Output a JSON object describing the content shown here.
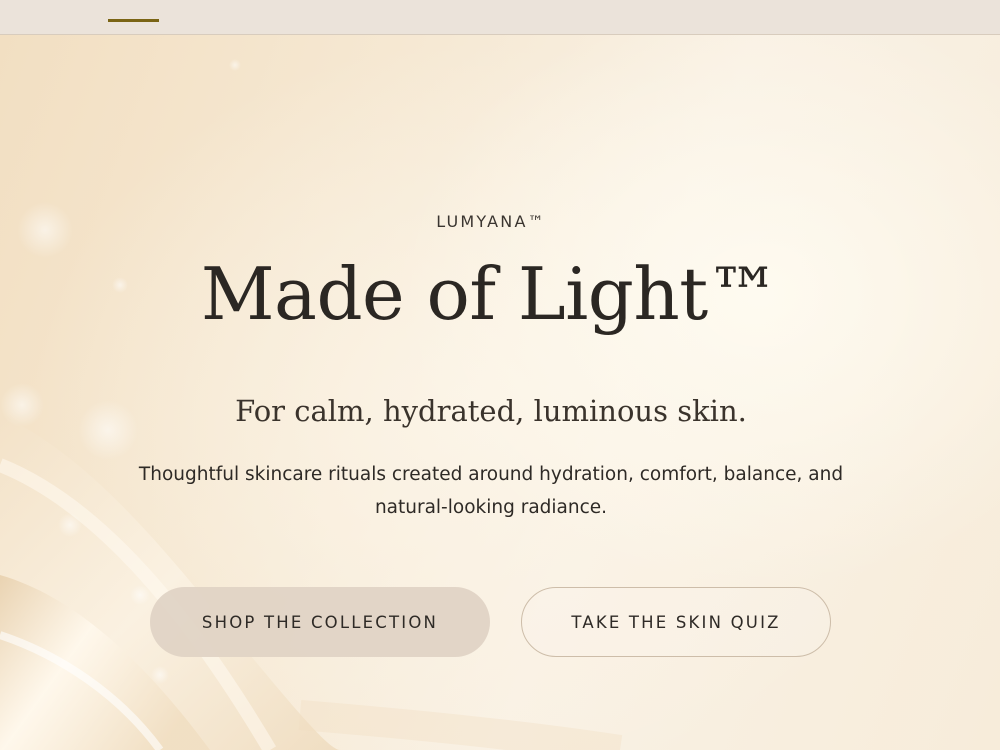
{
  "colors": {
    "background": "#f6ecda",
    "topbar": "#ebe3da",
    "nav_indicator": "#7a6414",
    "text": "#2b2723",
    "primary_button": "#e0d3c4",
    "secondary_button_border": "#cdbda9"
  },
  "hero": {
    "brand": "LUMYANA™",
    "headline": "Made of Light™",
    "subheadline": "For calm, hydrated, luminous skin.",
    "description": "Thoughtful skincare rituals created around hydration, comfort, balance, and natural-looking radiance.",
    "primary_cta": "SHOP THE COLLECTION",
    "secondary_cta": "TAKE THE SKIN QUIZ"
  }
}
